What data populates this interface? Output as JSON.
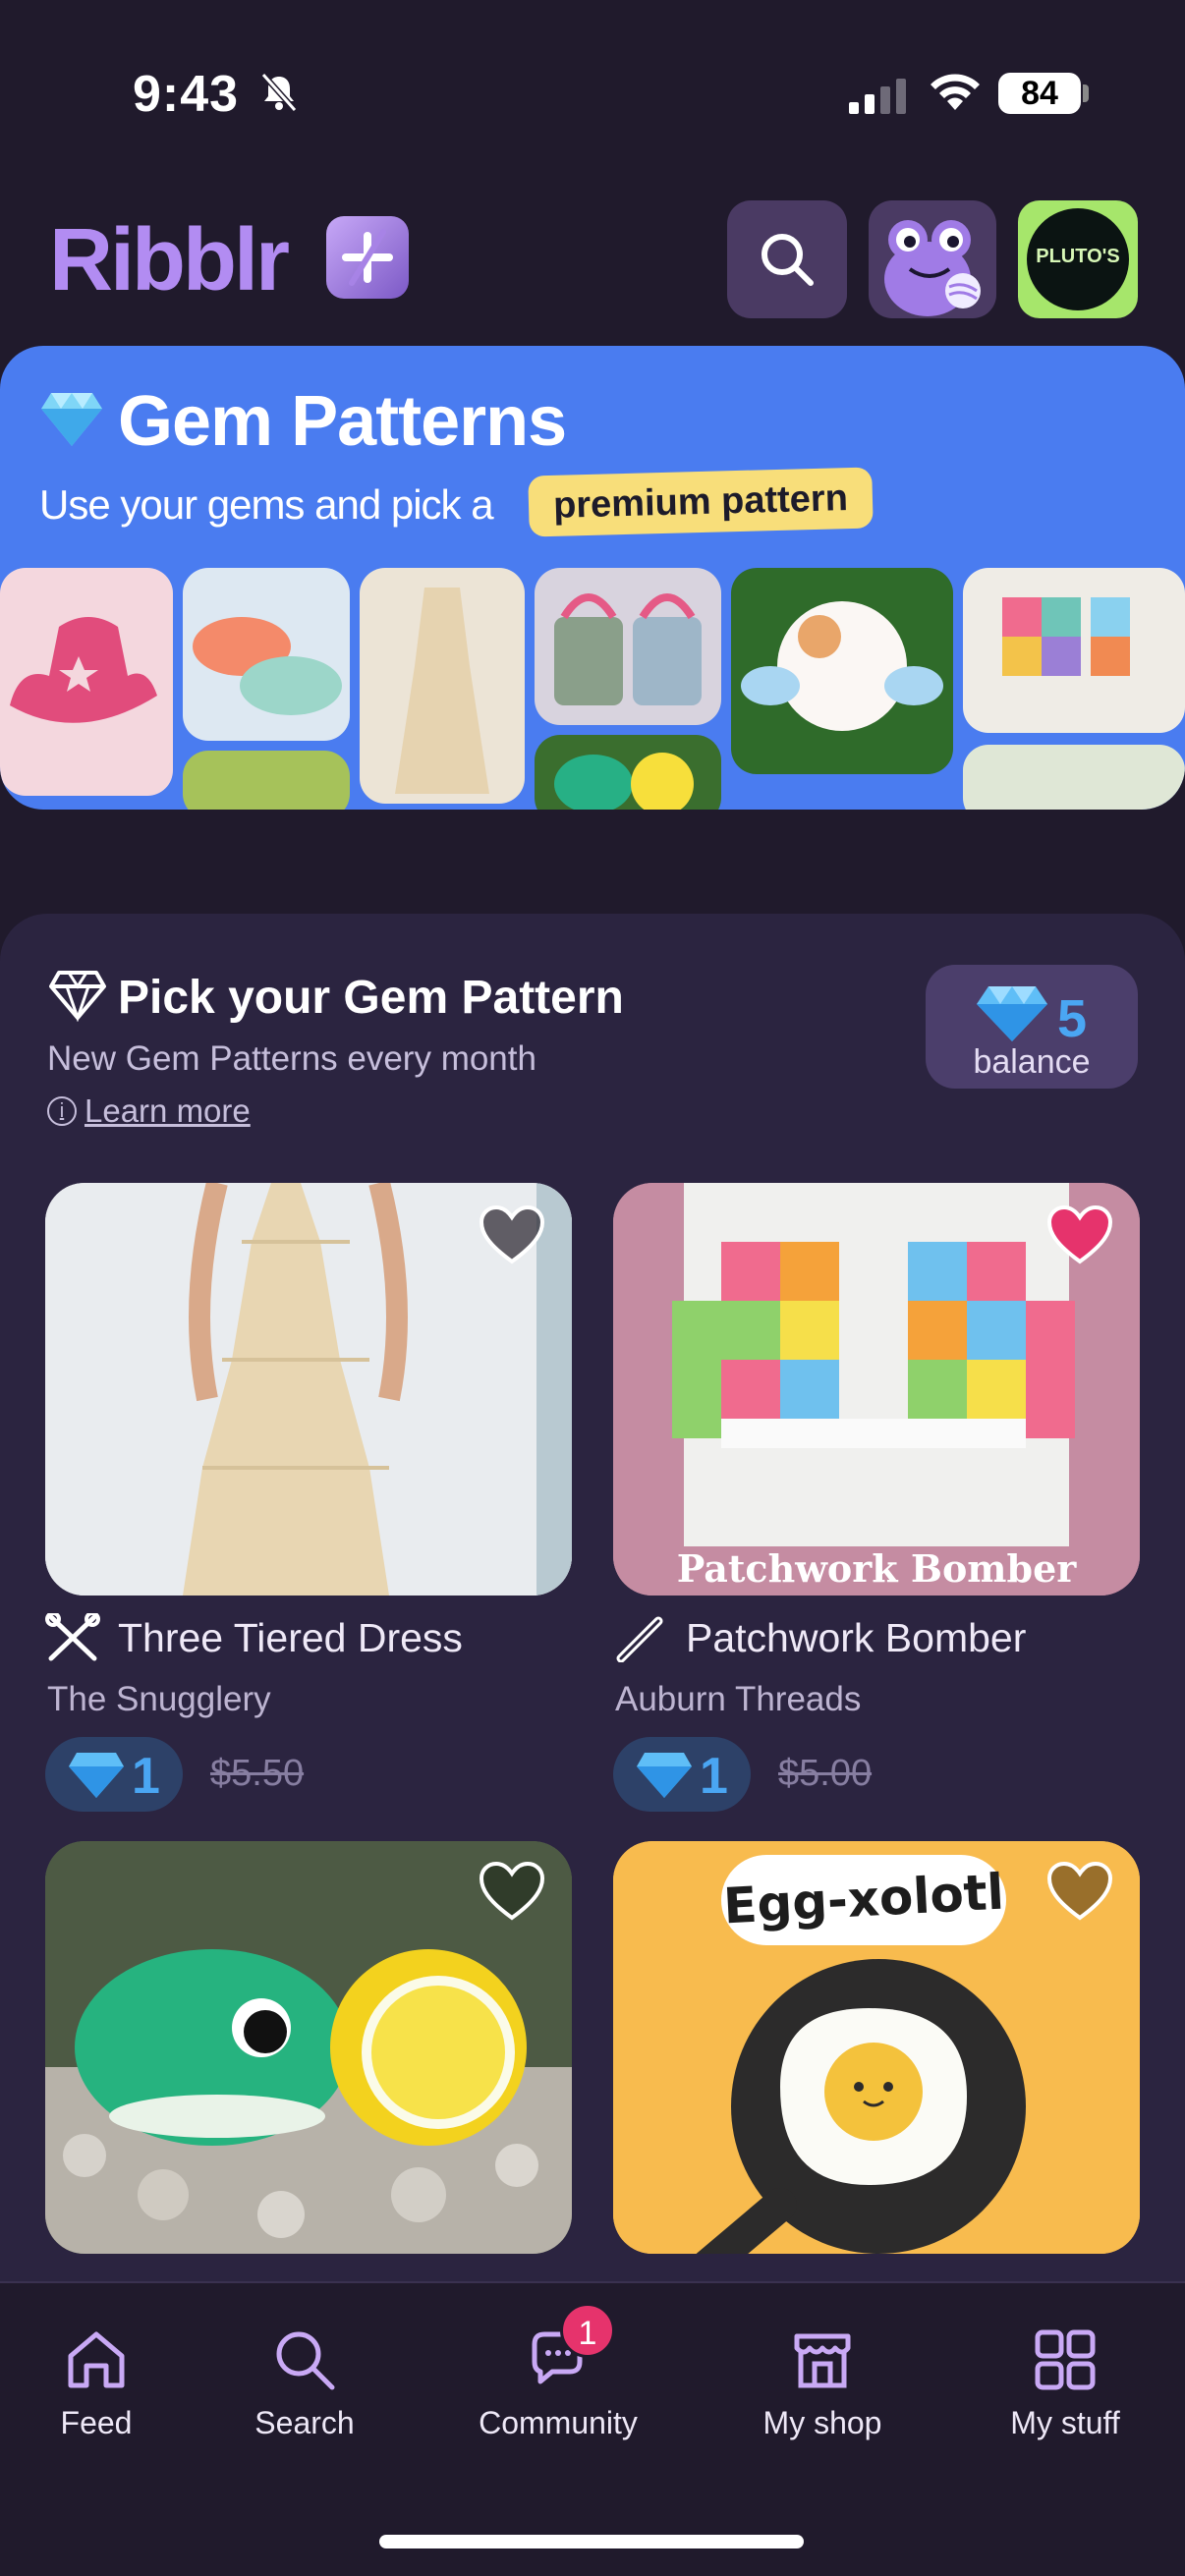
{
  "status_bar": {
    "time": "9:43",
    "battery": "84"
  },
  "header": {
    "logo": "Ribblr"
  },
  "avatar2": {
    "text": "PLUTO'S"
  },
  "banner": {
    "title": "Gem Patterns",
    "subtitle": "Use your gems and pick a",
    "highlight": "premium pattern"
  },
  "section": {
    "title": "Pick your Gem Pattern",
    "subtitle": "New Gem Patterns every month",
    "learn_more": "Learn more",
    "balance_value": "5",
    "balance_label": "balance"
  },
  "cards": [
    {
      "title": "Three Tiered Dress",
      "seller": "The Snugglery",
      "gems": "1",
      "old_price": "$5.50",
      "liked": false,
      "craft_icon": "knitting-needles-icon"
    },
    {
      "title": "Patchwork Bomber",
      "seller": "Auburn Threads",
      "gems": "1",
      "old_price": "$5.00",
      "liked": true,
      "image_caption": "Patchwork Bomber",
      "craft_icon": "crochet-hook-icon"
    },
    {
      "title": "",
      "liked": false
    },
    {
      "title": "",
      "liked": false,
      "image_caption": "Egg-xolotl"
    }
  ],
  "nav": {
    "items": [
      {
        "label": "Feed",
        "icon": "home-icon"
      },
      {
        "label": "Search",
        "icon": "search-icon"
      },
      {
        "label": "Community",
        "icon": "community-icon",
        "badge": "1"
      },
      {
        "label": "My shop",
        "icon": "shop-icon"
      },
      {
        "label": "My stuff",
        "icon": "grid-icon"
      }
    ]
  },
  "colors": {
    "accent": "#b28cf2",
    "banner": "#4a7cf0",
    "gem": "#4aa6f3",
    "heart_active": "#e6336c",
    "background": "#201a2c"
  }
}
